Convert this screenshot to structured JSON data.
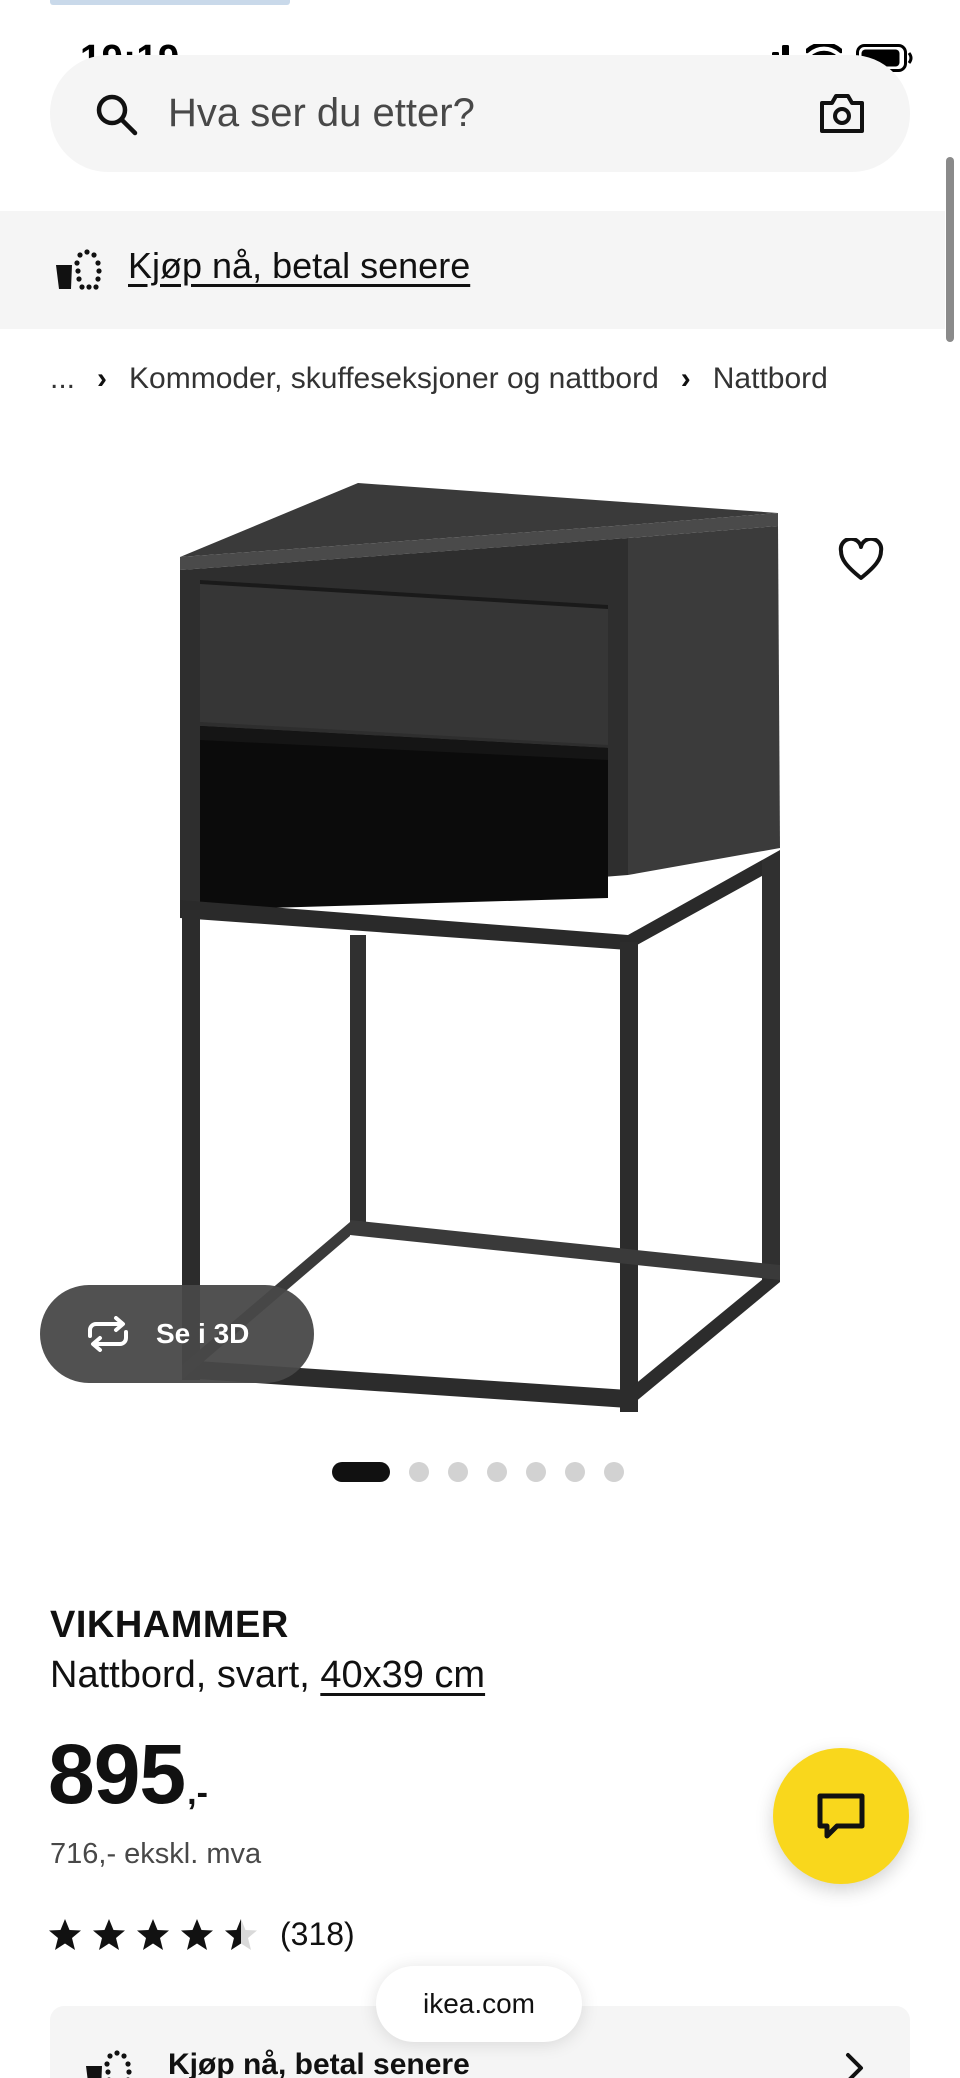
{
  "status_bar": {
    "time": "19:19"
  },
  "search": {
    "placeholder": "Hva ser du etter?"
  },
  "promo": {
    "text": "Kjøp nå, betal senere"
  },
  "breadcrumb": {
    "ellipsis": "...",
    "items": [
      "Kommoder, skuffeseksjoner og nattbord",
      "Nattbord"
    ]
  },
  "media": {
    "view3d_label": "Se i 3D",
    "slide_count": 7,
    "active_slide": 1
  },
  "product": {
    "name": "VIKHAMMER",
    "description": "Nattbord, svart, ",
    "size": "40x39 cm",
    "price": "895",
    "price_suffix": ",-",
    "price_ex_vat": "716,- ekskl. mva",
    "rating_value": 4.5,
    "rating_max": 5,
    "review_count": "(318)"
  },
  "footer": {
    "site": "ikea.com",
    "installment_label": "Kjøp nå, betal senere"
  },
  "colors": {
    "chat_button": "#f9d71c",
    "panel_bg": "#f5f5f5",
    "product_color": "black"
  },
  "icons": [
    "search-icon",
    "camera-icon",
    "cart-dots-icon",
    "heart-icon",
    "rotate-3d-icon",
    "chat-icon",
    "star-icon",
    "chevron-right-icon"
  ]
}
